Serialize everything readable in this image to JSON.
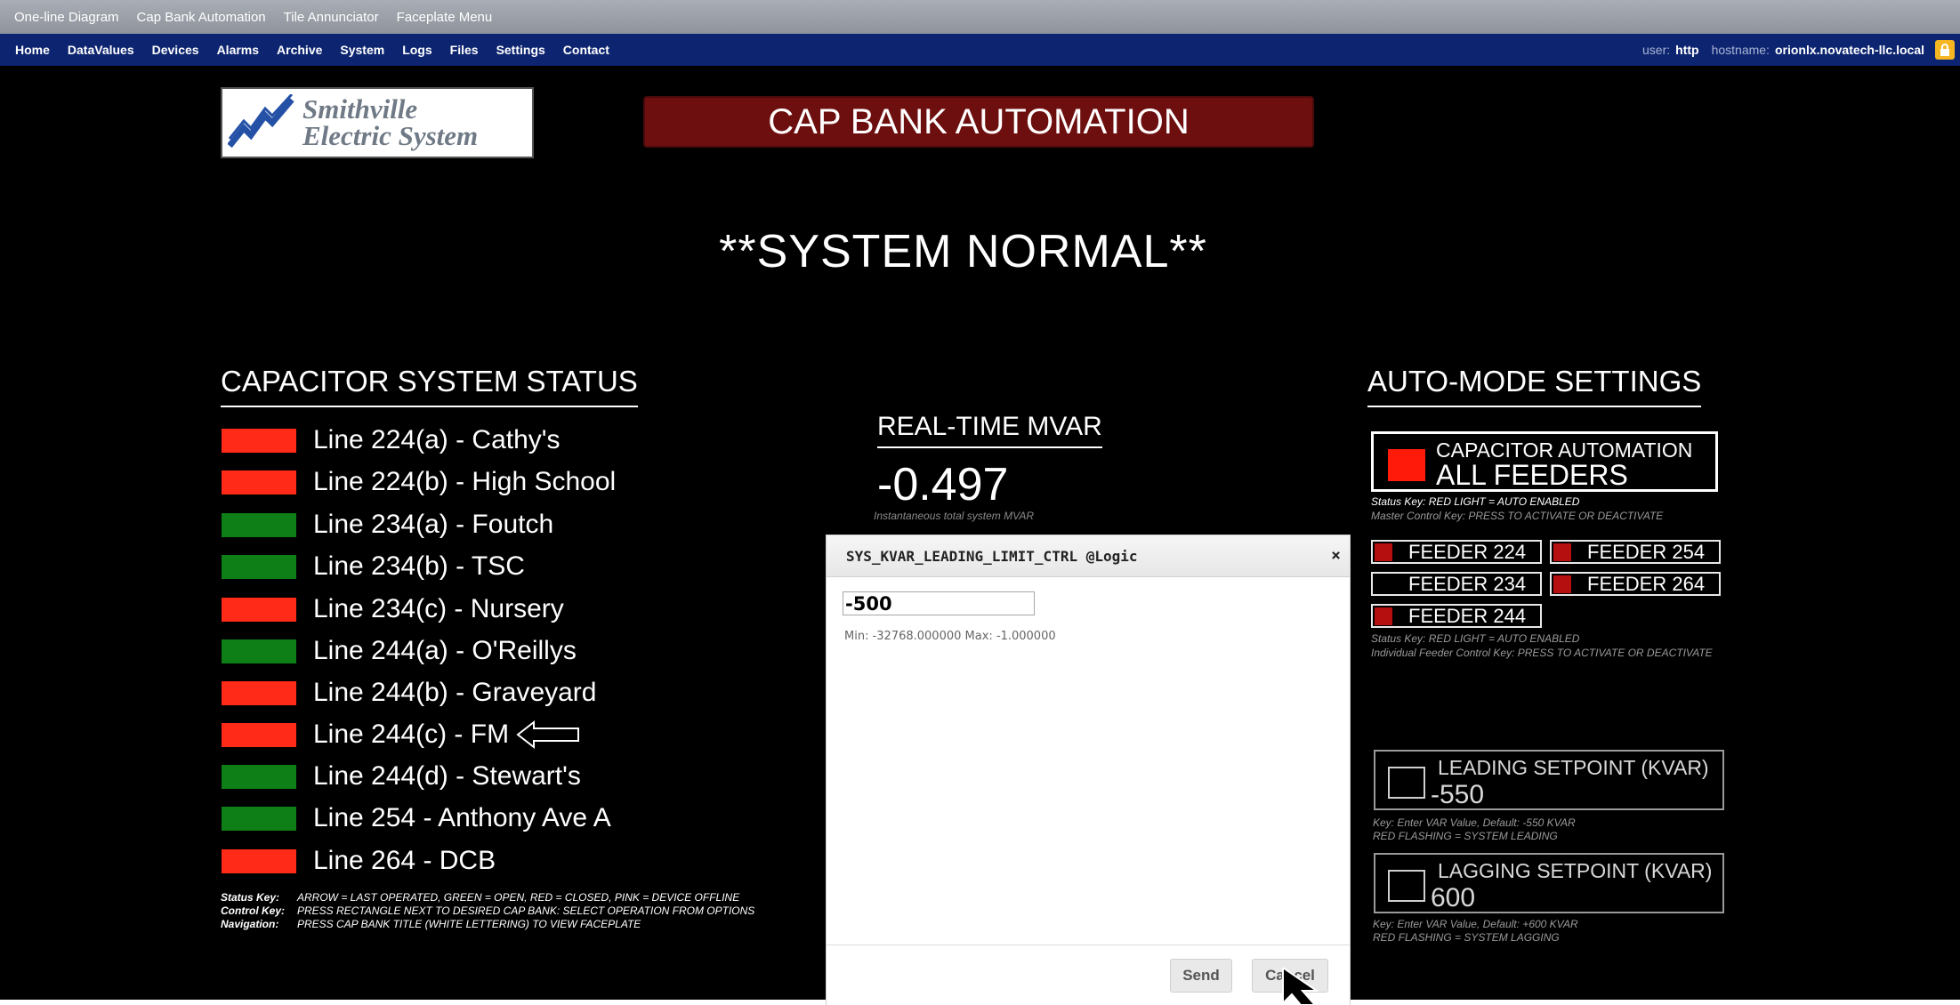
{
  "top_menu": [
    "One-line Diagram",
    "Cap Bank Automation",
    "Tile Annunciator",
    "Faceplate Menu"
  ],
  "nav": {
    "items": [
      "Home",
      "DataValues",
      "Devices",
      "Alarms",
      "Archive",
      "System",
      "Logs",
      "Files",
      "Settings",
      "Contact"
    ],
    "user_label": "user:",
    "user": "http",
    "hostname_label": "hostname:",
    "hostname": "orionlx.novatech-llc.local",
    "lock_icon": "lock-icon"
  },
  "logo": {
    "line1": "Smithville",
    "line2": "Electric System"
  },
  "title": "CAP BANK AUTOMATION",
  "system_status": "**SYSTEM NORMAL**",
  "capacitor": {
    "heading": "CAPACITOR SYSTEM STATUS",
    "lines": [
      {
        "label": "Line 224(a) - Cathy's",
        "state": "red"
      },
      {
        "label": "Line 224(b) - High School",
        "state": "red"
      },
      {
        "label": "Line 234(a) - Foutch",
        "state": "green"
      },
      {
        "label": "Line 234(b) - TSC",
        "state": "green"
      },
      {
        "label": "Line 234(c) - Nursery",
        "state": "red"
      },
      {
        "label": "Line 244(a) - O'Reillys",
        "state": "green"
      },
      {
        "label": "Line 244(b) - Graveyard",
        "state": "red"
      },
      {
        "label": "Line 244(c) - FM",
        "state": "red",
        "last_operated": true
      },
      {
        "label": "Line 244(d) - Stewart's",
        "state": "green"
      },
      {
        "label": "Line 254 - Anthony Ave A",
        "state": "green"
      },
      {
        "label": "Line 264 - DCB",
        "state": "red"
      }
    ],
    "keys": [
      {
        "key": "Status Key:",
        "text": "ARROW = LAST OPERATED,  GREEN = OPEN, RED = CLOSED, PINK = DEVICE OFFLINE"
      },
      {
        "key": "Control Key:",
        "text": "PRESS RECTANGLE NEXT TO DESIRED CAP BANK: SELECT OPERATION FROM OPTIONS"
      },
      {
        "key": "Navigation:",
        "text": "PRESS CAP BANK TITLE (WHITE LETTERING) TO VIEW FACEPLATE"
      }
    ]
  },
  "mvar": {
    "heading": "REAL-TIME MVAR",
    "value": "-0.497",
    "caption": "Instantaneous total system MVAR"
  },
  "auto_mode": {
    "heading": "AUTO-MODE SETTINGS",
    "master_line1": "CAPACITOR AUTOMATION",
    "master_line2": "ALL FEEDERS",
    "master_status_key": "Status Key: RED LIGHT = AUTO ENABLED",
    "master_control_key": "Master Control Key: PRESS TO ACTIVATE OR DEACTIVATE",
    "feeders": [
      {
        "label": "FEEDER 224",
        "enabled": true
      },
      {
        "label": "FEEDER 254",
        "enabled": true
      },
      {
        "label": "FEEDER 234",
        "enabled": false
      },
      {
        "label": "FEEDER 264",
        "enabled": true
      },
      {
        "label": "FEEDER 244",
        "enabled": true
      }
    ],
    "feeder_status_key": "Status Key: RED LIGHT = AUTO ENABLED",
    "feeder_control_key": "Individual Feeder Control Key: PRESS TO ACTIVATE OR DEACTIVATE",
    "leading": {
      "label": "LEADING SETPOINT (KVAR)",
      "value": "-550",
      "key1": "Key:  Enter VAR Value, Default: -550 KVAR",
      "key2": "RED FLASHING = SYSTEM LEADING"
    },
    "lagging": {
      "label": "LAGGING SETPOINT (KVAR)",
      "value": "600",
      "key1": "Key:  Enter VAR Value, Default: +600 KVAR",
      "key2": "RED FLASHING = SYSTEM LAGGING"
    }
  },
  "dialog": {
    "title": "SYS_KVAR_LEADING_LIMIT_CTRL @Logic",
    "close": "×",
    "value": "-500",
    "range": "Min: -32768.000000 Max: -1.000000",
    "send": "Send",
    "cancel": "Cancel"
  },
  "colors": {
    "closed_red": "#ff2a17",
    "open_green": "#0d7f16",
    "nav_blue": "#0d2570",
    "title_red": "#6e0f0f",
    "feeder_on": "#b50f0f"
  }
}
